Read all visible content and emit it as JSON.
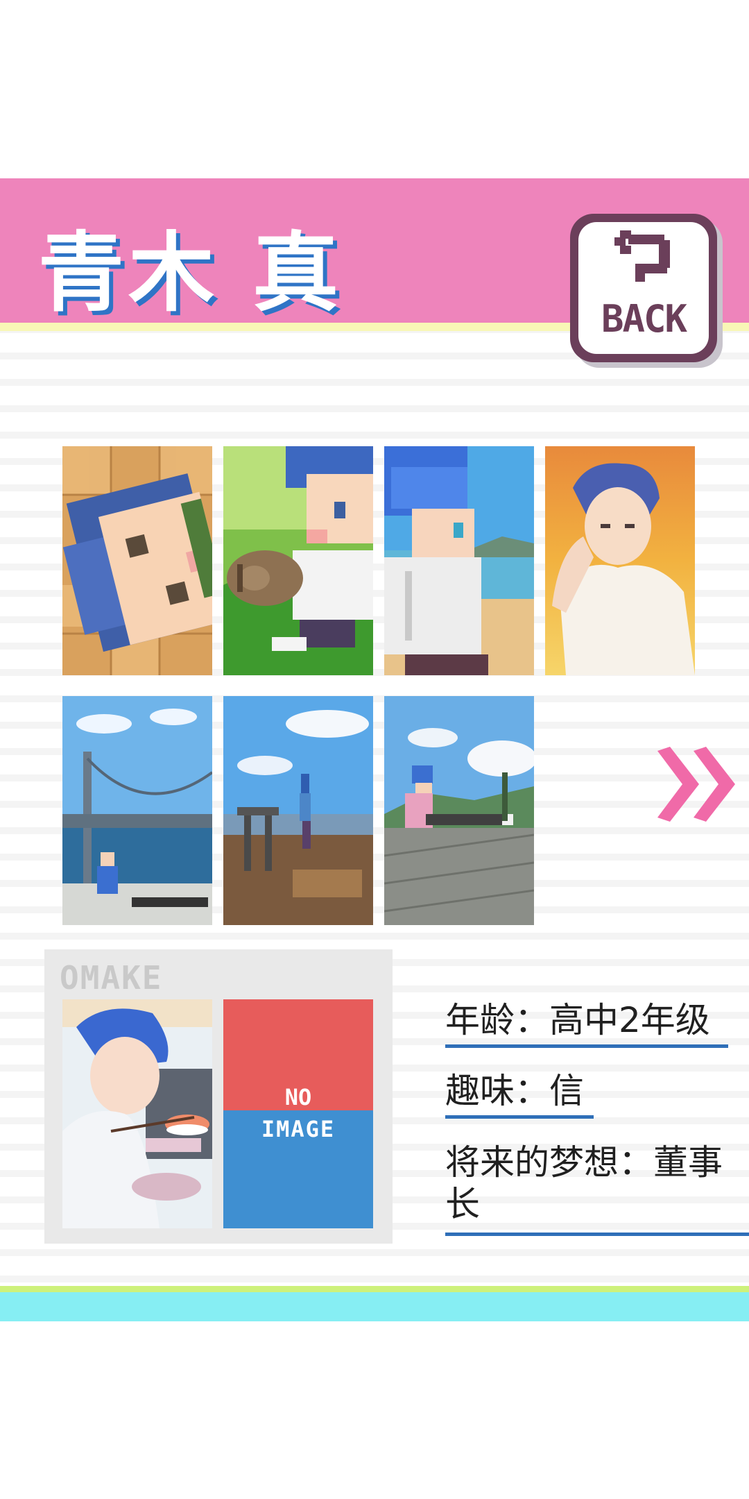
{
  "header": {
    "character_name": "青木 真",
    "back_label": "BACK"
  },
  "gallery": {
    "thumbnails": [
      {
        "id": 1,
        "subject": "pixel-face-close-up"
      },
      {
        "id": 2,
        "subject": "pixel-boy-with-cat"
      },
      {
        "id": 3,
        "subject": "pixel-boy-at-beach"
      },
      {
        "id": 4,
        "subject": "anime-boy-sunset"
      },
      {
        "id": 5,
        "subject": "bridge-scene"
      },
      {
        "id": 6,
        "subject": "viewpoint-scene"
      },
      {
        "id": 7,
        "subject": "boy-sitting-on-deck"
      }
    ]
  },
  "omake": {
    "label": "OMAKE",
    "no_image_line1": "NO",
    "no_image_line2": "IMAGE"
  },
  "profile": {
    "age": "年龄：高中2年级",
    "hobby": "趣味：信",
    "dream": "将来的梦想：董事长"
  },
  "colors": {
    "header_pink": "#ee84bb",
    "name_shadow_blue": "#2f74c6",
    "back_button_purple": "#6b3f5a",
    "next_arrow_pink": "#f06aa8",
    "underline_blue": "#2f6fb8",
    "no_image_red": "#e75c5b",
    "no_image_blue": "#3f8fd1",
    "bottom_green": "#cdf17a",
    "bottom_cyan": "#86eef3"
  },
  "icons": {
    "back": "back-return-arrow-icon",
    "next": "double-chevron-right-icon"
  }
}
